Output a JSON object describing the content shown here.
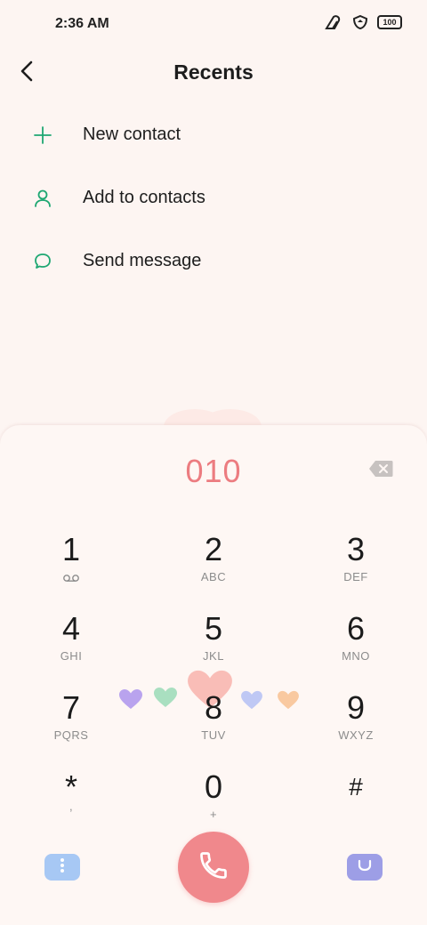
{
  "status_bar": {
    "time": "2:36 AM",
    "battery": "100",
    "icons": [
      "signal-icon",
      "vpn-shield-icon",
      "battery-icon"
    ]
  },
  "header": {
    "title": "Recents",
    "back_icon": "back-arrow-icon"
  },
  "actions": [
    {
      "label": "New contact",
      "icon": "plus-icon"
    },
    {
      "label": "Add to contacts",
      "icon": "person-icon"
    },
    {
      "label": "Send message",
      "icon": "message-bubble-icon"
    }
  ],
  "dialer": {
    "number": "010",
    "backspace_icon": "backspace-icon"
  },
  "keypad": [
    {
      "digit": "1",
      "letters": ""
    },
    {
      "digit": "2",
      "letters": "ABC"
    },
    {
      "digit": "3",
      "letters": "DEF"
    },
    {
      "digit": "4",
      "letters": "GHI"
    },
    {
      "digit": "5",
      "letters": "JKL"
    },
    {
      "digit": "6",
      "letters": "MNO"
    },
    {
      "digit": "7",
      "letters": "PQRS"
    },
    {
      "digit": "8",
      "letters": "TUV"
    },
    {
      "digit": "9",
      "letters": "WXYZ"
    },
    {
      "digit": "*",
      "letters": ","
    },
    {
      "digit": "0",
      "letters": "+"
    },
    {
      "digit": "#",
      "letters": ""
    }
  ],
  "key_1_icon": "voicemail-icon",
  "bottom_bar": {
    "menu_icon": "more-vertical-icon",
    "call_icon": "phone-icon",
    "emoji_icon": "smile-keyboard-icon"
  },
  "colors": {
    "accent": "#1ea772",
    "dialed_number": "#ec7c80",
    "call_button": "#f0888c",
    "menu_button": "#a7c8f4",
    "emoji_button": "#9d9ee6",
    "background": "#fdf5f2"
  }
}
